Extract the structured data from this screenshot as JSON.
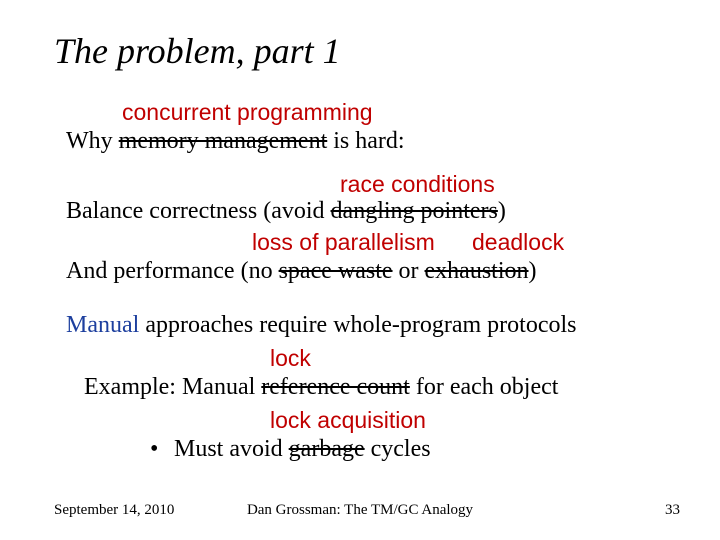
{
  "title": "The problem, part 1",
  "line1": {
    "annotation": "concurrent programming",
    "pre": "Why ",
    "struck": "memory management",
    "post": " is hard:"
  },
  "line2": {
    "annotation": "race conditions",
    "pre": "Balance correctness (avoid ",
    "struck": "dangling pointers",
    "post": ")"
  },
  "line3": {
    "ann1": "loss of parallelism",
    "ann2": "deadlock",
    "pre": "And performance (no ",
    "struck1": "space waste",
    "mid": " or ",
    "struck2": "exhaustion",
    "post": ")"
  },
  "line4": {
    "manual": "Manual",
    "rest": " approaches require whole-program protocols"
  },
  "line5": {
    "annotation": "lock",
    "pre": "Example: Manual ",
    "struck": "reference count",
    "post": " for each object"
  },
  "line6": {
    "annotation": "lock  acquisition",
    "bullet": "•",
    "pre": " Must avoid ",
    "struck": "garbage",
    "post": " cycles"
  },
  "footer": {
    "date": "September 14, 2010",
    "center": "Dan Grossman: The TM/GC Analogy",
    "page": "33"
  }
}
